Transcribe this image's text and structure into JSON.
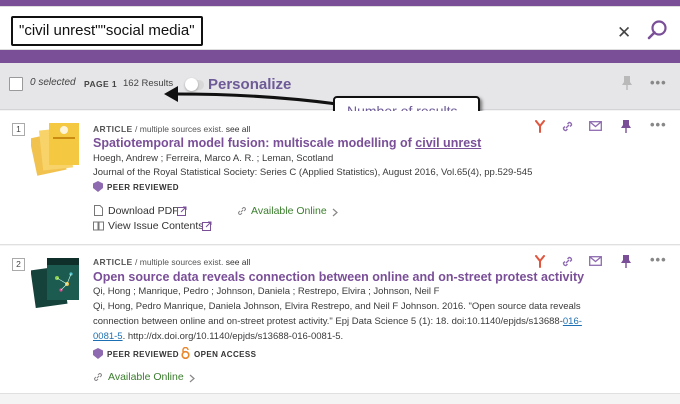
{
  "search": {
    "query": "\"civil unrest\"\"social media\"",
    "clear_symbol": "✕"
  },
  "toolbar": {
    "selected_text": "0 selected",
    "page_label": "PAGE 1",
    "results_count": "162 Results",
    "personalize_label": "Personalize",
    "more_symbol": "•••"
  },
  "callout": {
    "text": "Number of results"
  },
  "results": [
    {
      "number": "1",
      "type_label": "ARTICLE",
      "sources_text": "/ multiple sources exist.",
      "see_all": "see all",
      "title_prefix": "Spatiotemporal model fusion: multiscale modelling of ",
      "title_highlight": "civil unrest",
      "authors": "Hoegh, Andrew ; Ferreira, Marco A. R. ; Leman, Scotland",
      "source": "Journal of the Royal Statistical Society: Series C (Applied Statistics), August 2016, Vol.65(4), pp.529-545",
      "peer_reviewed": "PEER REVIEWED",
      "download_pdf": "Download PDF",
      "view_issue": "View Issue Contents",
      "available_online": "Available Online",
      "more_symbol": "•••"
    },
    {
      "number": "2",
      "type_label": "ARTICLE",
      "sources_text": "/ multiple sources exist.",
      "see_all": "see all",
      "title": "Open source data reveals connection between online and on-street protest activity",
      "authors": "Qi, Hong ; Manrique, Pedro ; Johnson, Daniela ; Restrepo, Elvira ; Johnson, Neil F",
      "citation_line1_prefix": "Qi, Hong, Pedro Manrique, Daniela Johnson, Elvira Restrepo, and Neil F Johnson. 2016. \"Open source data reveals",
      "citation_line2_prefix": "connection between online and on-street protest activity.\" Epj Data Science 5 (1): 18. doi:10.1140/epjds/s13688-",
      "citation_link_a": "016-",
      "citation_link_b": "0081-5",
      "citation_line3_suffix": ". http://dx.doi.org/10.1140/epjds/s13688-016-0081-5.",
      "peer_reviewed": "PEER REVIEWED",
      "open_access": "OPEN ACCESS",
      "available_online": "Available Online",
      "more_symbol": "•••"
    }
  ],
  "colors": {
    "brand": "#7a4f98",
    "action_red": "#e0563f",
    "action_purple": "#8e6bb0",
    "available_green": "#3a7d2c",
    "link_blue": "#1c6fb3"
  },
  "icons": [
    "search-icon",
    "close-icon",
    "pin-icon",
    "more-icon",
    "citation-icon",
    "permalink-icon",
    "email-icon",
    "pdf-icon",
    "book-icon",
    "external-link-icon",
    "link-icon",
    "chevron-right-icon",
    "peer-reviewed-icon",
    "open-access-icon"
  ]
}
